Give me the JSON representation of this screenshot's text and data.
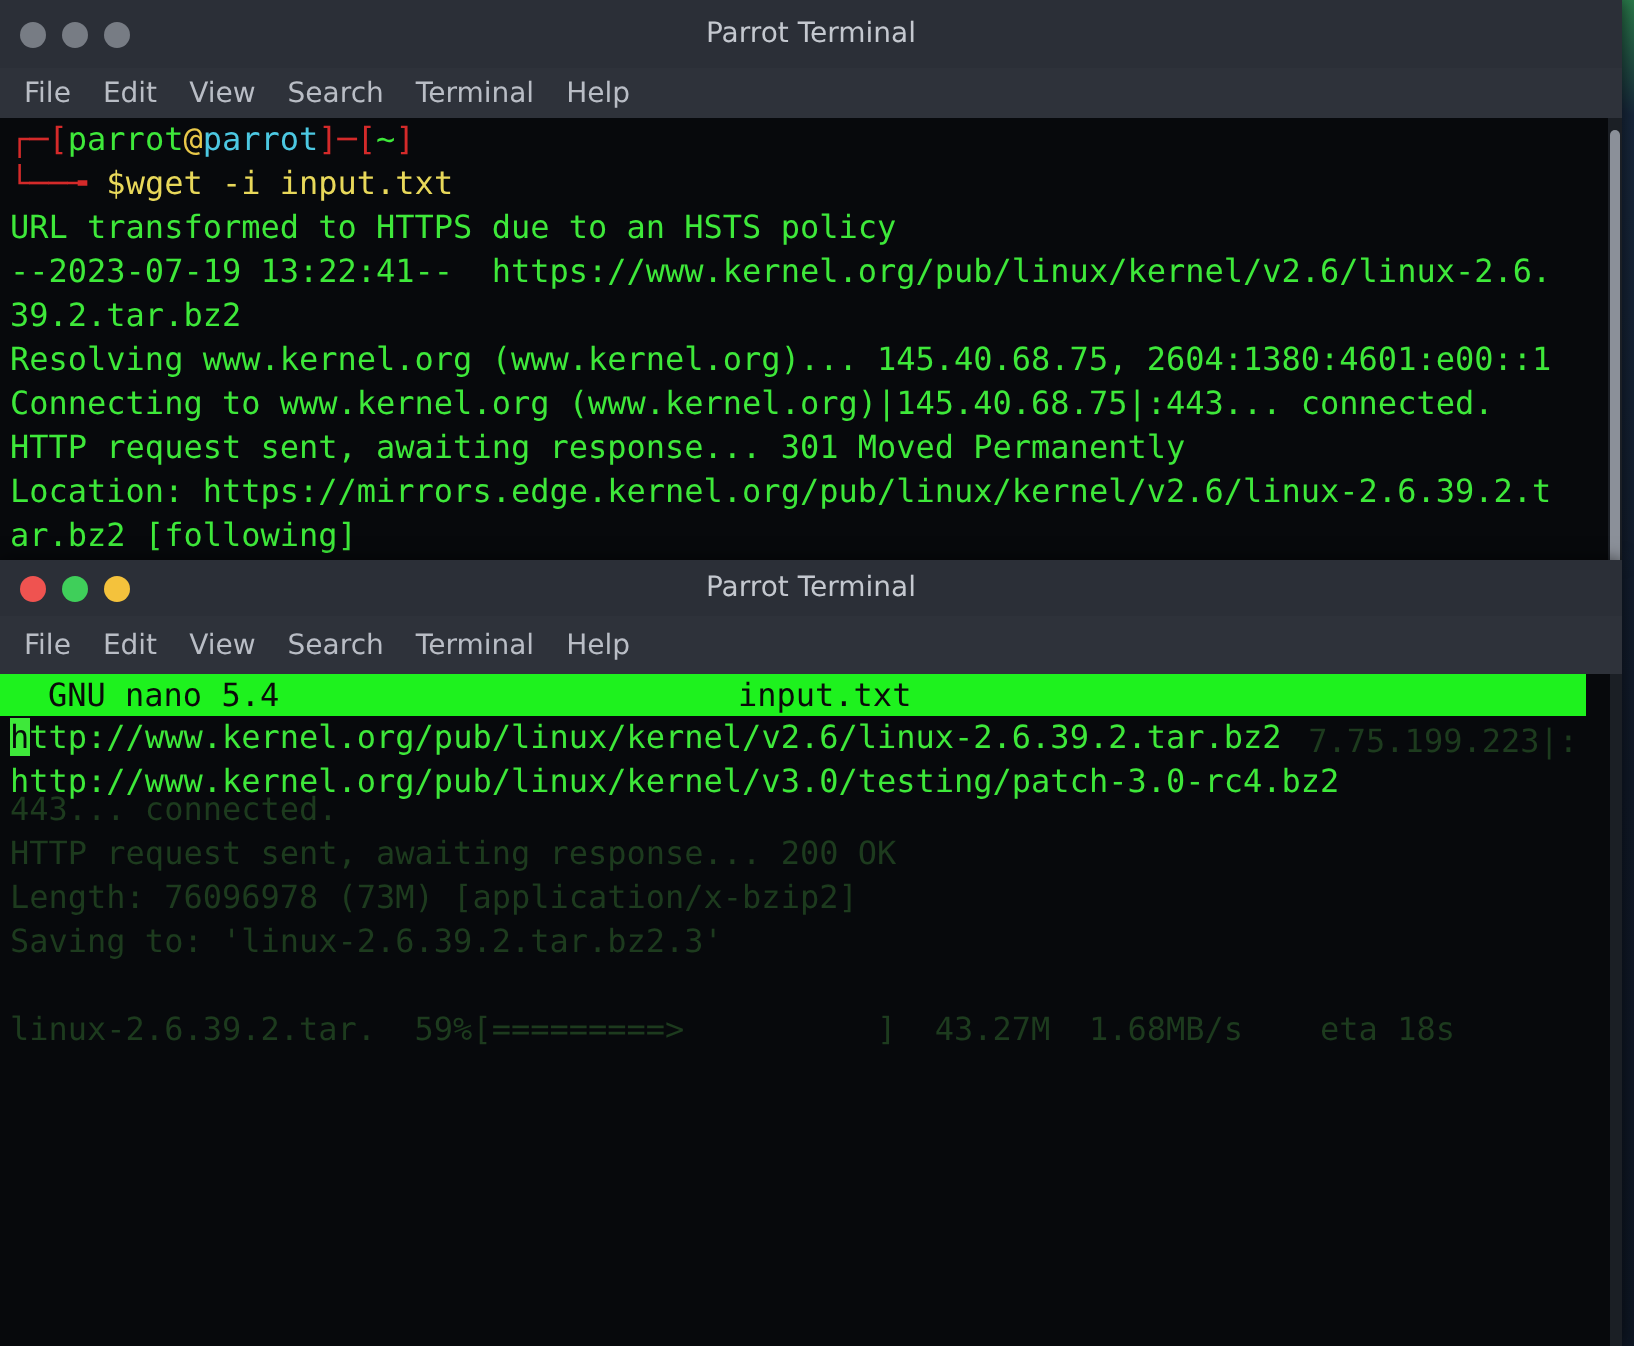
{
  "windows": [
    {
      "title": "Parrot Terminal",
      "active": false,
      "menu": [
        "File",
        "Edit",
        "View",
        "Search",
        "Terminal",
        "Help"
      ],
      "prompt": {
        "line1": [
          {
            "text": "┌─[",
            "color": "#d42a2a"
          },
          {
            "text": "parrot",
            "color": "#3ee83a"
          },
          {
            "text": "@",
            "color": "#e8c84a"
          },
          {
            "text": "parrot",
            "color": "#4cc8e2"
          },
          {
            "text": "]─[",
            "color": "#d42a2a"
          },
          {
            "text": "~",
            "color": "#3ee83a"
          },
          {
            "text": "]",
            "color": "#d42a2a"
          }
        ],
        "line2": [
          {
            "text": "└──╼ ",
            "color": "#d42a2a"
          },
          {
            "text": "$",
            "color": "#e8d85a"
          },
          {
            "text": "wget -i input.txt",
            "color": "#e8d85a"
          }
        ]
      },
      "output": [
        "URL transformed to HTTPS due to an HSTS policy",
        "--2023-07-19 13:22:41--  https://www.kernel.org/pub/linux/kernel/v2.6/linux-2.6.",
        "39.2.tar.bz2",
        "Resolving www.kernel.org (www.kernel.org)... 145.40.68.75, 2604:1380:4601:e00::1",
        "Connecting to www.kernel.org (www.kernel.org)|145.40.68.75|:443... connected.",
        "HTTP request sent, awaiting response... 301 Moved Permanently",
        "Location: https://mirrors.edge.kernel.org/pub/linux/kernel/v2.6/linux-2.6.39.2.t",
        "ar.bz2 [following]"
      ]
    },
    {
      "title": "Parrot Terminal",
      "active": true,
      "menu": [
        "File",
        "Edit",
        "View",
        "Search",
        "Terminal",
        "Help"
      ],
      "nano": {
        "version": "GNU nano 5.4",
        "filename": "input.txt",
        "lines": [
          {
            "text": "http://www.kernel.org/pub/linux/kernel/v2.6/linux-2.6.39.2.tar.bz2",
            "cursor": true
          },
          {
            "text": "http://www.kernel.org/pub/linux/kernel/v3.0/testing/patch-3.0-rc4.bz2",
            "cursor": false
          }
        ]
      },
      "behind_text": [
        {
          "kind": "tail",
          "text": "7.75.199.223|:"
        },
        {
          "kind": "line",
          "text": "443... connected."
        },
        {
          "kind": "line",
          "text": "HTTP request sent, awaiting response... 200 OK"
        },
        {
          "kind": "line",
          "text": "Length: 76096978 (73M) [application/x-bzip2]"
        },
        {
          "kind": "line",
          "text": "Saving to: 'linux-2.6.39.2.tar.bz2.3'"
        },
        {
          "kind": "blank"
        },
        {
          "kind": "line",
          "text": "linux-2.6.39.2.tar.  59%[=========>          ]  43.27M  1.68MB/s    eta 18s"
        }
      ]
    }
  ]
}
